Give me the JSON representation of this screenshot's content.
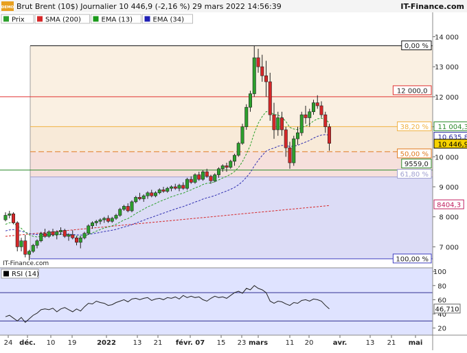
{
  "header": {
    "title": "Brut Brent (10$) Journalier 10 446,9 (-2,16 %) 29 mars 2022 14:56:39",
    "site": "IT-Finance.com",
    "demo_badge": "DEMO"
  },
  "legend": [
    {
      "label": "Prix",
      "color": "#2ca02c"
    },
    {
      "label": "SMA (200)",
      "color": "#d62728"
    },
    {
      "label": "EMA (13)",
      "color": "#1a9a1a"
    },
    {
      "label": "EMA (34)",
      "color": "#1f1fb4"
    }
  ],
  "watermark": "IT-Finance.com",
  "colors": {
    "up": "#2ca02c",
    "down": "#d62728",
    "ema13": "#2ca02c",
    "ema34": "#2f2fb0",
    "sma200": "#d62728",
    "rsi": "#222222"
  },
  "chart_data": [
    {
      "type": "candlestick",
      "ylim": [
        6300,
        14400
      ],
      "yticks": [
        7000,
        8000,
        9000,
        10000,
        11000,
        12000,
        13000,
        14000
      ],
      "ytick_labels": [
        "7 000",
        "8 000",
        "9 000",
        "10 000",
        "11 000",
        "12 000",
        "13 000",
        "14 000"
      ],
      "x_labels": [
        "24",
        "déc.",
        "10",
        "19",
        "2022",
        "13",
        "21",
        "févr. 07",
        "15",
        "23",
        "mars",
        "11",
        "20",
        "avr.",
        "13",
        "21",
        "mai"
      ],
      "ohlc": [
        [
          7900,
          8150,
          7850,
          8050
        ],
        [
          8050,
          8200,
          7950,
          8100
        ],
        [
          8100,
          8150,
          7750,
          7800
        ],
        [
          7800,
          7850,
          6850,
          7000
        ],
        [
          7000,
          7300,
          6850,
          7200
        ],
        [
          7200,
          7400,
          6650,
          6750
        ],
        [
          6750,
          6900,
          6550,
          6850
        ],
        [
          6850,
          7100,
          6800,
          7050
        ],
        [
          7050,
          7250,
          6950,
          7200
        ],
        [
          7200,
          7500,
          7150,
          7450
        ],
        [
          7450,
          7600,
          7300,
          7350
        ],
        [
          7350,
          7550,
          7300,
          7500
        ],
        [
          7500,
          7600,
          7350,
          7400
        ],
        [
          7400,
          7550,
          7250,
          7500
        ],
        [
          7500,
          7650,
          7400,
          7550
        ],
        [
          7550,
          7600,
          7300,
          7350
        ],
        [
          7350,
          7450,
          7200,
          7400
        ],
        [
          7400,
          7550,
          7250,
          7300
        ],
        [
          7300,
          7350,
          7050,
          7150
        ],
        [
          7150,
          7350,
          6950,
          7300
        ],
        [
          7300,
          7500,
          7250,
          7450
        ],
        [
          7450,
          7750,
          7400,
          7700
        ],
        [
          7700,
          7850,
          7600,
          7800
        ],
        [
          7800,
          7900,
          7700,
          7850
        ],
        [
          7850,
          7950,
          7750,
          7900
        ],
        [
          7900,
          8000,
          7800,
          7950
        ],
        [
          7950,
          8050,
          7800,
          7850
        ],
        [
          7850,
          8000,
          7800,
          7950
        ],
        [
          7950,
          8100,
          7900,
          8050
        ],
        [
          8050,
          8300,
          8000,
          8250
        ],
        [
          8250,
          8400,
          8200,
          8350
        ],
        [
          8350,
          8450,
          8150,
          8200
        ],
        [
          8200,
          8550,
          8150,
          8500
        ],
        [
          8500,
          8700,
          8450,
          8650
        ],
        [
          8650,
          8800,
          8550,
          8600
        ],
        [
          8600,
          8750,
          8500,
          8700
        ],
        [
          8700,
          8850,
          8600,
          8800
        ],
        [
          8800,
          8900,
          8650,
          8700
        ],
        [
          8700,
          8850,
          8650,
          8800
        ],
        [
          8800,
          8950,
          8750,
          8900
        ],
        [
          8900,
          9000,
          8800,
          8850
        ],
        [
          8850,
          9000,
          8800,
          8950
        ],
        [
          8950,
          9050,
          8850,
          9000
        ],
        [
          9000,
          9100,
          8900,
          8950
        ],
        [
          8950,
          9100,
          8850,
          9050
        ],
        [
          9050,
          9150,
          8900,
          8950
        ],
        [
          8950,
          9300,
          8900,
          9250
        ],
        [
          9250,
          9350,
          9100,
          9150
        ],
        [
          9150,
          9450,
          9100,
          9400
        ],
        [
          9400,
          9500,
          9200,
          9250
        ],
        [
          9250,
          9550,
          9200,
          9500
        ],
        [
          9500,
          9600,
          9300,
          9350
        ],
        [
          9350,
          9400,
          9100,
          9200
        ],
        [
          9200,
          9450,
          9150,
          9400
        ],
        [
          9400,
          9650,
          9300,
          9600
        ],
        [
          9600,
          9750,
          9500,
          9700
        ],
        [
          9700,
          9800,
          9500,
          9650
        ],
        [
          9650,
          9900,
          9600,
          9850
        ],
        [
          9850,
          10100,
          9700,
          10050
        ],
        [
          10050,
          10500,
          10000,
          10450
        ],
        [
          10450,
          11100,
          10400,
          11000
        ],
        [
          11000,
          11750,
          10900,
          11650
        ],
        [
          11650,
          12200,
          11500,
          12100
        ],
        [
          12100,
          13700,
          12000,
          13300
        ],
        [
          13300,
          13600,
          12800,
          13000
        ],
        [
          13000,
          13400,
          12500,
          12700
        ],
        [
          12700,
          13200,
          12000,
          12500
        ],
        [
          12500,
          12800,
          11200,
          11400
        ],
        [
          11400,
          11800,
          10600,
          10900
        ],
        [
          10900,
          11500,
          10700,
          11300
        ],
        [
          11300,
          11500,
          10700,
          10900
        ],
        [
          10900,
          11000,
          10000,
          10300
        ],
        [
          10300,
          10500,
          9600,
          9800
        ],
        [
          9800,
          10700,
          9700,
          10600
        ],
        [
          10600,
          11000,
          10400,
          10800
        ],
        [
          10800,
          11500,
          10700,
          11400
        ],
        [
          11400,
          11700,
          11100,
          11300
        ],
        [
          11300,
          11600,
          11000,
          11500
        ],
        [
          11500,
          11900,
          11400,
          11800
        ],
        [
          11800,
          12050,
          11600,
          11700
        ],
        [
          11700,
          11850,
          11300,
          11400
        ],
        [
          11400,
          11500,
          10800,
          11000
        ],
        [
          11000,
          11100,
          10200,
          10447
        ]
      ]
    },
    {
      "type": "line",
      "name": "RSI (14)",
      "ylim": [
        10,
        105
      ],
      "yticks": [
        20,
        40,
        60,
        80,
        100
      ],
      "ytick_labels": [
        "20",
        "40",
        "60",
        "80",
        "100"
      ],
      "levels": [
        70,
        30
      ],
      "values": [
        36,
        38,
        34,
        30,
        35,
        28,
        33,
        38,
        41,
        46,
        47,
        46,
        48,
        43,
        47,
        49,
        46,
        43,
        47,
        44,
        50,
        55,
        54,
        58,
        56,
        55,
        52,
        53,
        56,
        58,
        60,
        57,
        61,
        62,
        60,
        62,
        63,
        59,
        61,
        62,
        60,
        63,
        62,
        64,
        61,
        66,
        63,
        65,
        63,
        64,
        60,
        58,
        62,
        65,
        63,
        64,
        62,
        66,
        70,
        72,
        69,
        76,
        74,
        80,
        76,
        74,
        70,
        58,
        55,
        58,
        57,
        54,
        52,
        56,
        55,
        59,
        60,
        58,
        61,
        60,
        58,
        52,
        47
      ],
      "last_label": "46,710"
    }
  ],
  "fibonacci": [
    {
      "label": "0,00 %",
      "value": 13700,
      "color": "#111111"
    },
    {
      "label": "38,20 %",
      "value": 11004.3,
      "color": "#f0b040"
    },
    {
      "label": "50,00 %",
      "value": 10170,
      "color": "#e07a20"
    },
    {
      "label": "61,80 %",
      "value": 9330,
      "color": "#a0a0d0"
    },
    {
      "label": "100,00 %",
      "value": 6600,
      "color": "#4040c0"
    }
  ],
  "levels": [
    {
      "label": "12 000,0",
      "value": 12000,
      "color": "#e03030"
    },
    {
      "label": "9559,0",
      "value": 9559,
      "color": "#2a8a2a"
    }
  ],
  "indicator_labels": [
    {
      "label": "11 004,3",
      "value": 11004.3,
      "color": "#2a8a2a"
    },
    {
      "label": "10 635,8",
      "value": 10635.8,
      "color": "#2a2aa0"
    },
    {
      "label": "10 446,9",
      "value": 10446.9,
      "color": "#000000",
      "highlight": true
    },
    {
      "label": "8404,3",
      "value": 8404.3,
      "color": "#c02060"
    }
  ],
  "rsi_legend": {
    "label": "RSI (14)"
  }
}
